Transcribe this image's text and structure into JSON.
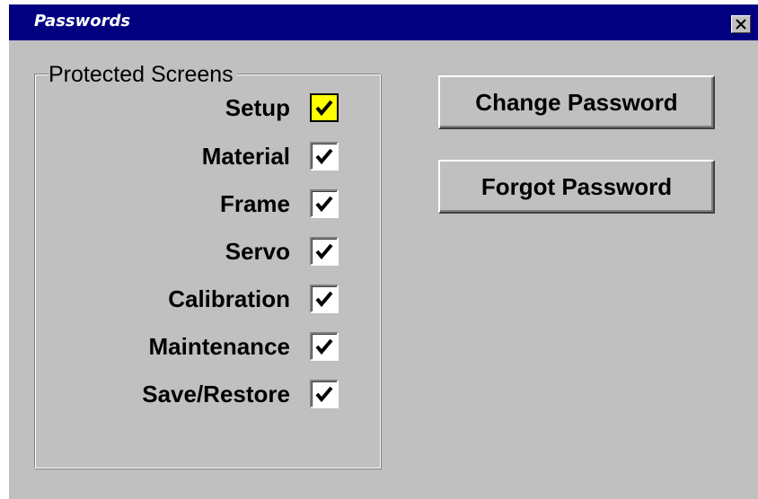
{
  "window": {
    "title": "Passwords"
  },
  "group": {
    "title": "Protected Screens",
    "items": [
      {
        "label": "Setup",
        "checked": true,
        "highlighted": true
      },
      {
        "label": "Material",
        "checked": true,
        "highlighted": false
      },
      {
        "label": "Frame",
        "checked": true,
        "highlighted": false
      },
      {
        "label": "Servo",
        "checked": true,
        "highlighted": false
      },
      {
        "label": "Calibration",
        "checked": true,
        "highlighted": false
      },
      {
        "label": "Maintenance",
        "checked": true,
        "highlighted": false
      },
      {
        "label": "Save/Restore",
        "checked": true,
        "highlighted": false
      }
    ]
  },
  "buttons": {
    "change_password": "Change Password",
    "forgot_password": "Forgot Password"
  },
  "icons": {
    "close": "close-icon",
    "check": "checkmark-icon"
  },
  "colors": {
    "titlebar": "#000080",
    "window_bg": "#c0c0c0",
    "highlight": "#ffff00"
  }
}
